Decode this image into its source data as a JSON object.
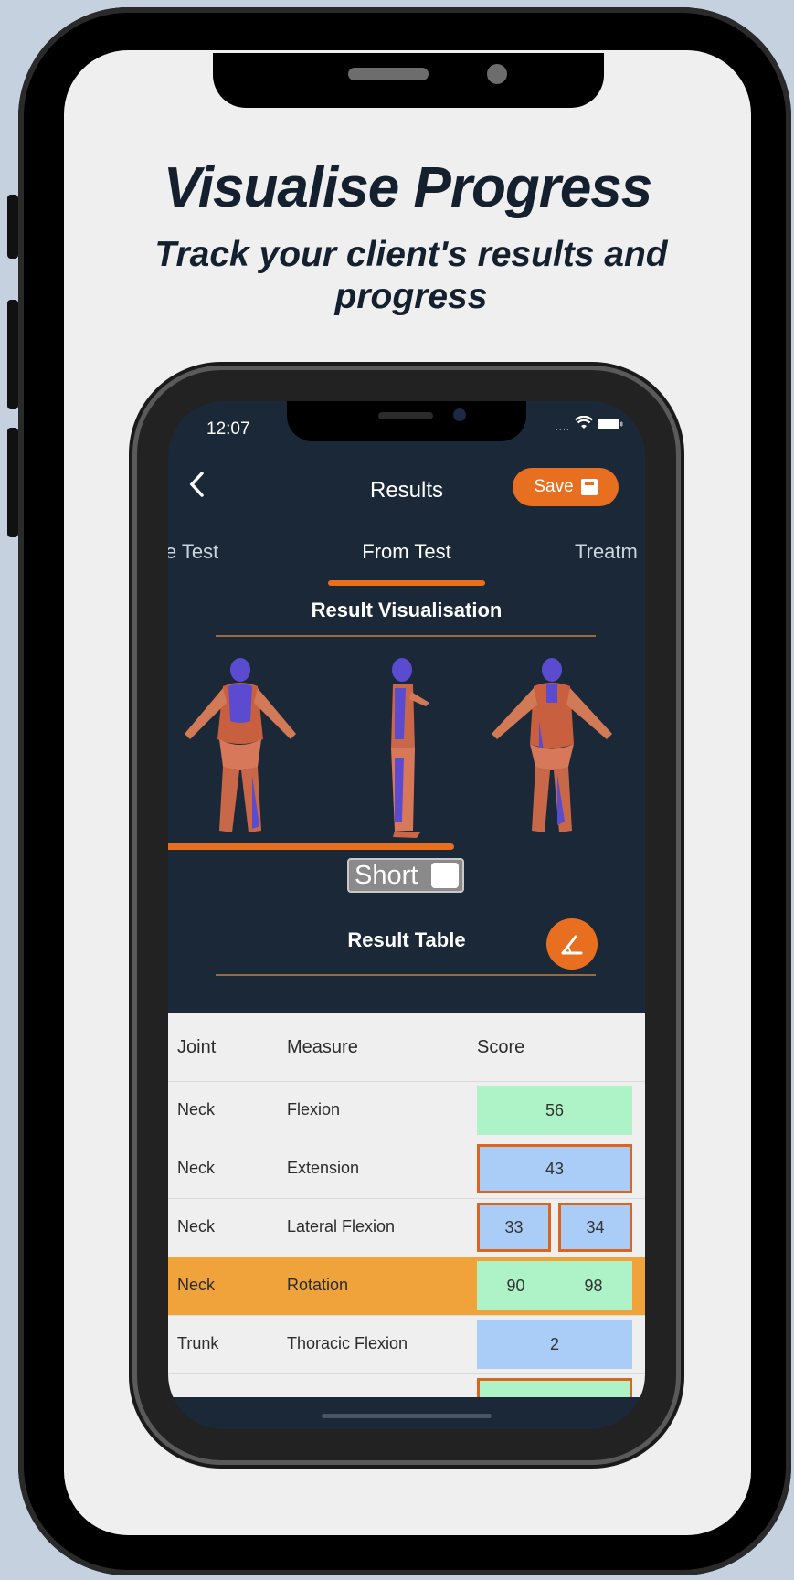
{
  "promo": {
    "headline": "Visualise Progress",
    "subheadline": "Track your client's results and progress"
  },
  "status_bar": {
    "time": "12:07"
  },
  "header": {
    "title": "Results",
    "save_label": "Save",
    "back_icon": "chevron-left-icon"
  },
  "tabs": [
    {
      "label": "ie Test"
    },
    {
      "label": "From Test",
      "active": true
    },
    {
      "label": "Treatm"
    }
  ],
  "sections": {
    "visualisation_title": "Result Visualisation",
    "table_title": "Result Table"
  },
  "toggle": {
    "label": "Short",
    "on": false
  },
  "table": {
    "headers": [
      "Joint",
      "Measure",
      "Score"
    ],
    "rows": [
      {
        "joint": "Neck",
        "measure": "Flexion",
        "scores": [
          "56"
        ]
      },
      {
        "joint": "Neck",
        "measure": "Extension",
        "scores": [
          "43"
        ]
      },
      {
        "joint": "Neck",
        "measure": "Lateral Flexion",
        "scores": [
          "33",
          "34"
        ]
      },
      {
        "joint": "Neck",
        "measure": "Rotation",
        "scores": [
          "90",
          "98"
        ]
      },
      {
        "joint": "Trunk",
        "measure": "Thoracic Flexion",
        "scores": [
          "2"
        ]
      }
    ]
  },
  "colors": {
    "accent": "#e76f1f",
    "app_bg": "#1a2838",
    "score_green": "#aef2c8",
    "score_blue": "#a9cdf7",
    "row_highlight": "#f0a33a"
  }
}
